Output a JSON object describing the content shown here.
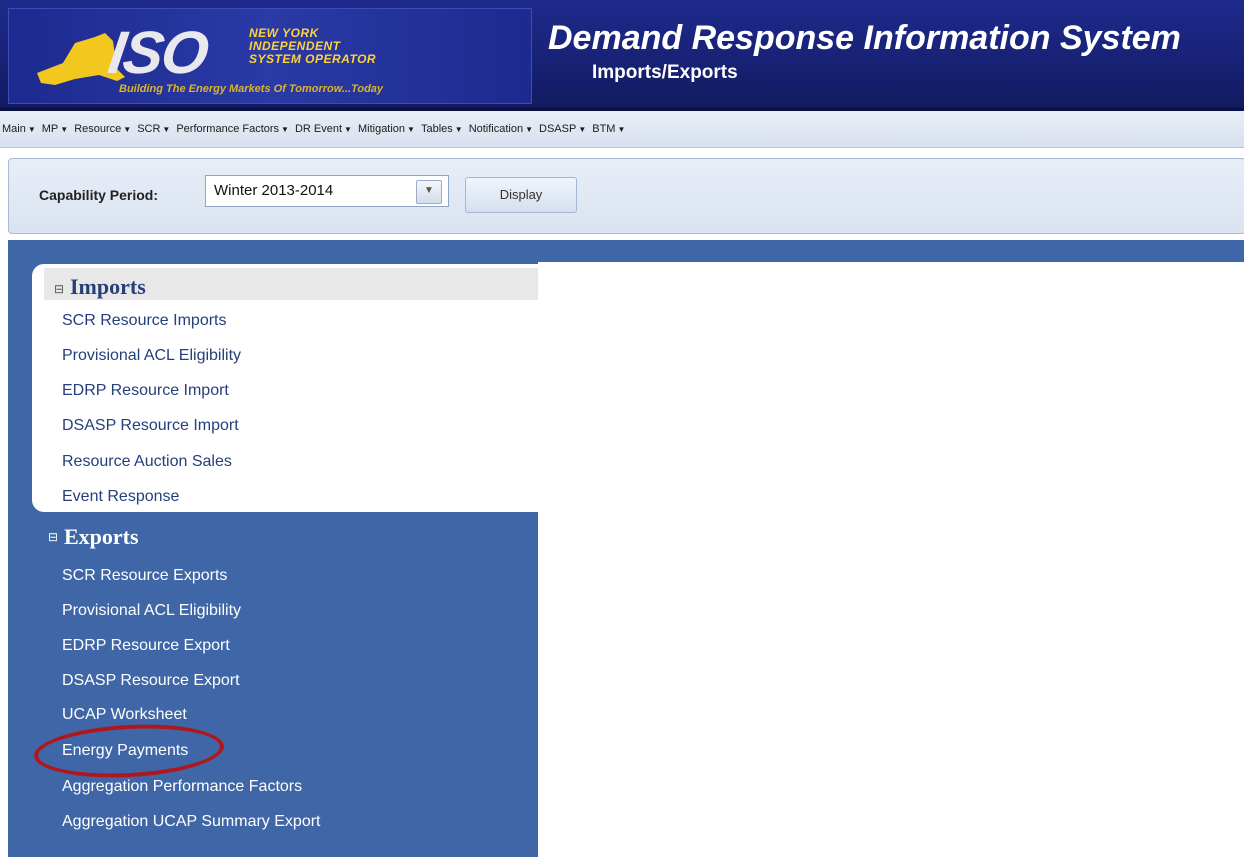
{
  "header": {
    "logo_text": "ISO",
    "logo_subtitle_lines": [
      "NEW YORK",
      "INDEPENDENT",
      "SYSTEM OPERATOR"
    ],
    "logo_tagline": "Building The Energy Markets Of Tomorrow...Today",
    "app_title": "Demand Response Information System",
    "page_subtitle": "Imports/Exports"
  },
  "menubar": {
    "items": [
      {
        "label": "Main"
      },
      {
        "label": "MP"
      },
      {
        "label": "Resource"
      },
      {
        "label": "SCR"
      },
      {
        "label": "Performance Factors"
      },
      {
        "label": "DR Event"
      },
      {
        "label": "Mitigation"
      },
      {
        "label": "Tables"
      },
      {
        "label": "Notification"
      },
      {
        "label": "DSASP"
      },
      {
        "label": "BTM"
      }
    ]
  },
  "toolbar": {
    "capability_label": "Capability Period:",
    "capability_value": "Winter 2013-2014",
    "display_label": "Display"
  },
  "nav": {
    "imports": {
      "title": "Imports",
      "icon": "⊟",
      "items": [
        "SCR Resource Imports",
        "Provisional ACL Eligibility",
        "EDRP Resource Import",
        "DSASP Resource Import",
        "Resource Auction Sales",
        "Event Response"
      ]
    },
    "exports": {
      "title": "Exports",
      "icon": "⊟",
      "items": [
        "SCR Resource Exports",
        "Provisional ACL Eligibility",
        "EDRP Resource Export",
        "DSASP Resource Export",
        "UCAP Worksheet",
        "Energy Payments",
        "Aggregation Performance Factors",
        "Aggregation UCAP Summary Export"
      ],
      "highlighted_item": "Energy Payments"
    }
  },
  "colors": {
    "banner": "#1e2a8c",
    "nav_blue": "#3f66a6",
    "highlight": "#b0161c"
  }
}
